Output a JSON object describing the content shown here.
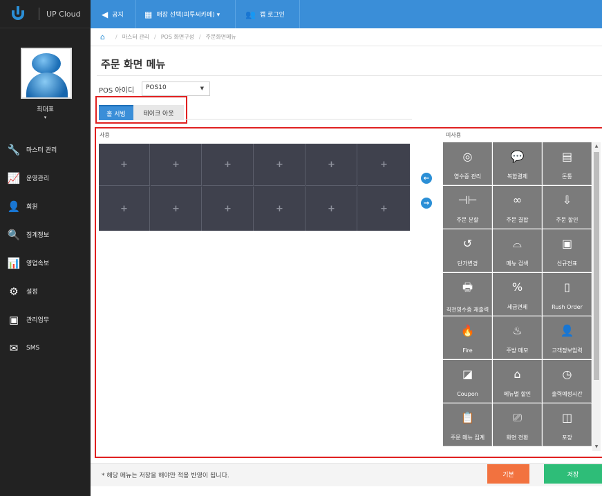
{
  "brand": {
    "name": "UP Cloud"
  },
  "topnav": [
    {
      "icon": "megaphone-icon",
      "label": "공지"
    },
    {
      "icon": "store-icon",
      "label": "매장 선택(피투씨카페) ▾"
    },
    {
      "icon": "users-icon",
      "label": "캡 로그인"
    }
  ],
  "user": {
    "name": "최대표",
    "caret": "▾"
  },
  "sidebar": {
    "items": [
      {
        "label": "마스터 관리",
        "icon": "wrench-icon"
      },
      {
        "label": "운영관리",
        "icon": "chart-icon"
      },
      {
        "label": "회원",
        "icon": "member-icon"
      },
      {
        "label": "집계정보",
        "icon": "aggregate-icon"
      },
      {
        "label": "영업속보",
        "icon": "bar-chart-icon"
      },
      {
        "label": "설정",
        "icon": "gear-icon"
      },
      {
        "label": "관리업무",
        "icon": "window-icon"
      },
      {
        "label": "SMS",
        "icon": "sms-icon"
      }
    ]
  },
  "breadcrumb": [
    "마스터 관리",
    "POS 화면구성",
    "주문화면메뉴"
  ],
  "page_title": "주문 화면 메뉴",
  "pos": {
    "label": "POS 아이디",
    "value": "POS10"
  },
  "tabs": [
    {
      "label": "홀 서빙",
      "active": true
    },
    {
      "label": "테이크 아웃",
      "active": false
    }
  ],
  "used": {
    "label": "사용",
    "plus": "+"
  },
  "unused": {
    "label": "미사용",
    "items": [
      {
        "label": "영수증 관리",
        "icon": "receipt-manage-icon"
      },
      {
        "label": "복합결제",
        "icon": "chat-icon"
      },
      {
        "label": "돈통",
        "icon": "cash-drawer-icon"
      },
      {
        "label": "주문 분할",
        "icon": "split-icon"
      },
      {
        "label": "주문 결합",
        "icon": "merge-icon"
      },
      {
        "label": "주문 할인",
        "icon": "discount-icon"
      },
      {
        "label": "단가변경",
        "icon": "price-change-icon"
      },
      {
        "label": "메뉴 검색",
        "icon": "bell-icon"
      },
      {
        "label": "신규전표",
        "icon": "new-slip-icon"
      },
      {
        "label": "직전영수증 재출력",
        "icon": "printer-icon"
      },
      {
        "label": "세금면제",
        "icon": "tax-icon"
      },
      {
        "label": "Rush Order",
        "icon": "rush-icon"
      },
      {
        "label": "Fire",
        "icon": "fire-icon"
      },
      {
        "label": "주방 메모",
        "icon": "chef-icon"
      },
      {
        "label": "고객정보입력",
        "icon": "customer-add-icon"
      },
      {
        "label": "Coupon",
        "icon": "coupon-icon"
      },
      {
        "label": "메뉴별 할인",
        "icon": "menu-discount-icon"
      },
      {
        "label": "출력예정시간",
        "icon": "chef-clock-icon"
      },
      {
        "label": "주문 메뉴 집계",
        "icon": "clipboard-icon"
      },
      {
        "label": "화면 전환",
        "icon": "screen-switch-icon"
      },
      {
        "label": "포장",
        "icon": "bag-icon"
      }
    ]
  },
  "footer": {
    "note": "* 해당 메뉴는 저장을 해야만 적용 반영이 됩니다.",
    "default_label": "기본",
    "save_label": "저장"
  }
}
